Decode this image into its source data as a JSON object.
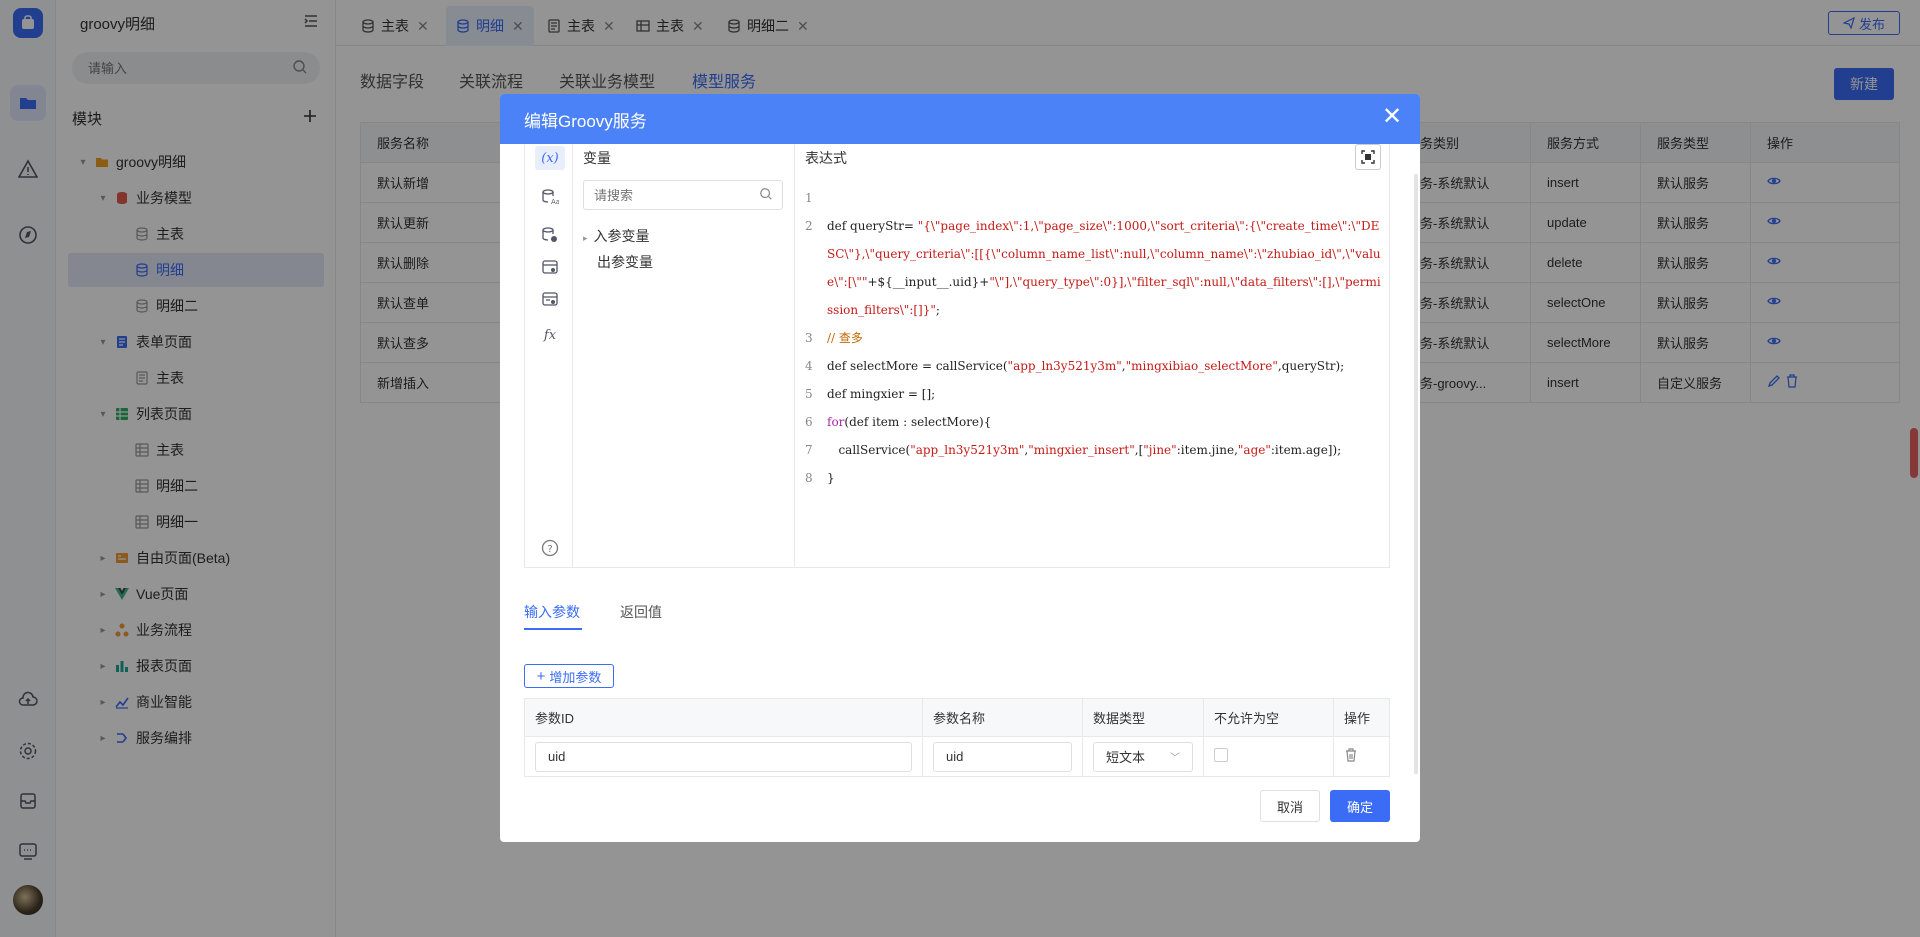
{
  "sidebar": {
    "title": "groovy明细",
    "search_placeholder": "请输入",
    "module_label": "模块",
    "tree": [
      {
        "label": "groovy明细",
        "icon": "folder-icon",
        "level": 0,
        "arrow": "▾"
      },
      {
        "label": "业务模型",
        "icon": "database-icon",
        "level": 1,
        "arrow": "▾"
      },
      {
        "label": "主表",
        "icon": "table-db-icon",
        "level": 2,
        "arrow": ""
      },
      {
        "label": "明细",
        "icon": "table-db-icon",
        "level": 2,
        "arrow": "",
        "selected": true
      },
      {
        "label": "明细二",
        "icon": "table-db-icon",
        "level": 2,
        "arrow": ""
      },
      {
        "label": "表单页面",
        "icon": "form-icon",
        "level": 1,
        "arrow": "▾"
      },
      {
        "label": "主表",
        "icon": "form-page-icon",
        "level": 2,
        "arrow": ""
      },
      {
        "label": "列表页面",
        "icon": "list-icon",
        "level": 1,
        "arrow": "▾"
      },
      {
        "label": "主表",
        "icon": "grid-icon",
        "level": 2,
        "arrow": ""
      },
      {
        "label": "明细二",
        "icon": "grid-icon",
        "level": 2,
        "arrow": ""
      },
      {
        "label": "明细一",
        "icon": "grid-icon",
        "level": 2,
        "arrow": ""
      },
      {
        "label": "自由页面(Beta)",
        "icon": "free-page-icon",
        "level": 1,
        "arrow": "▸"
      },
      {
        "label": "Vue页面",
        "icon": "vue-icon",
        "level": 1,
        "arrow": "▸"
      },
      {
        "label": "业务流程",
        "icon": "flow-icon",
        "level": 1,
        "arrow": "▸"
      },
      {
        "label": "报表页面",
        "icon": "report-icon",
        "level": 1,
        "arrow": "▸"
      },
      {
        "label": "商业智能",
        "icon": "bi-icon",
        "level": 1,
        "arrow": "▸"
      },
      {
        "label": "服务编排",
        "icon": "orchestration-icon",
        "level": 1,
        "arrow": "▸"
      }
    ]
  },
  "tabs": [
    {
      "label": "主表",
      "icon": "database-icon",
      "active": false
    },
    {
      "label": "明细",
      "icon": "database-icon",
      "active": true
    },
    {
      "label": "主表",
      "icon": "form-icon",
      "active": false
    },
    {
      "label": "主表",
      "icon": "table-icon",
      "active": false
    },
    {
      "label": "明细二",
      "icon": "database-icon",
      "active": false
    }
  ],
  "publish_label": "发布",
  "subtabs": [
    "数据字段",
    "关联流程",
    "关联业务模型",
    "模型服务"
  ],
  "new_label": "新建",
  "bg_table": {
    "headers": [
      "服务名称",
      "",
      "",
      "",
      "",
      "",
      "",
      "",
      "",
      "服务类别",
      "服务方式",
      "服务类型",
      "操作"
    ],
    "rows": [
      [
        "默认新增",
        "服务-系统默认",
        "insert",
        "默认服务"
      ],
      [
        "默认更新",
        "服务-系统默认",
        "update",
        "默认服务"
      ],
      [
        "默认删除",
        "服务-系统默认",
        "delete",
        "默认服务"
      ],
      [
        "默认查单",
        "服务-系统默认",
        "selectOne",
        "默认服务"
      ],
      [
        "默认查多",
        "服务-系统默认",
        "selectMore",
        "默认服务"
      ],
      [
        "新增插入",
        "服务-groovy...",
        "insert",
        "自定义服务"
      ]
    ]
  },
  "dialog": {
    "title": "编辑Groovy服务",
    "var_title": "变量",
    "var_search_placeholder": "请搜索",
    "in_vars": "入参变量",
    "out_vars": "出参变量",
    "expr_title": "表达式",
    "tabs": [
      "输入参数",
      "返回值"
    ],
    "add_param": "增加参数",
    "param_headers": [
      "参数ID",
      "参数名称",
      "数据类型",
      "不允许为空",
      "操作"
    ],
    "param_row": {
      "id": "uid",
      "name": "uid",
      "type": "短文本"
    },
    "cancel": "取消",
    "ok": "确定"
  },
  "code_lines": [
    {
      "n": "1",
      "html": ""
    },
    {
      "n": "2",
      "html": "def queryStr= <span class=\"str\">\"{\\\"page_index\\\":1,\\\"page_size\\\":1000,\\\"sort_criteria\\\":{\\\"create_time\\\":\\\"DESC\\\"},\\\"query_criteria\\\":[[{\\\"column_name_list\\\":null,\\\"column_name\\\":\\\"zhubiao_id\\\",\\\"value\\\":[\\\"\"</span>+${__input__.uid}+<span class=\"str\">\"\\\"],\\\"query_type\\\":0}],\\\"filter_sql\\\":null,\\\"data_filters\\\":[],\\\"permission_filters\\\":[]}\"</span>;"
    },
    {
      "n": "3",
      "html": "<span class=\"cmt\">// 查多</span>"
    },
    {
      "n": "4",
      "html": "def selectMore = callService(<span class=\"str\">\"app_ln3y521y3m\"</span>,<span class=\"str\">\"mingxibiao_selectMore\"</span>,queryStr);"
    },
    {
      "n": "5",
      "html": "def mingxier = [];"
    },
    {
      "n": "6",
      "html": "<span class=\"kw\">for</span>(def item : selectMore){"
    },
    {
      "n": "7",
      "html": "&nbsp;&nbsp;&nbsp;callService(<span class=\"str\">\"app_ln3y521y3m\"</span>,<span class=\"str\">\"mingxier_insert\"</span>,[<span class=\"str\">\"jine\"</span>:item.jine,<span class=\"str\">\"age\"</span>:item.age]);"
    },
    {
      "n": "8",
      "html": "}"
    }
  ]
}
